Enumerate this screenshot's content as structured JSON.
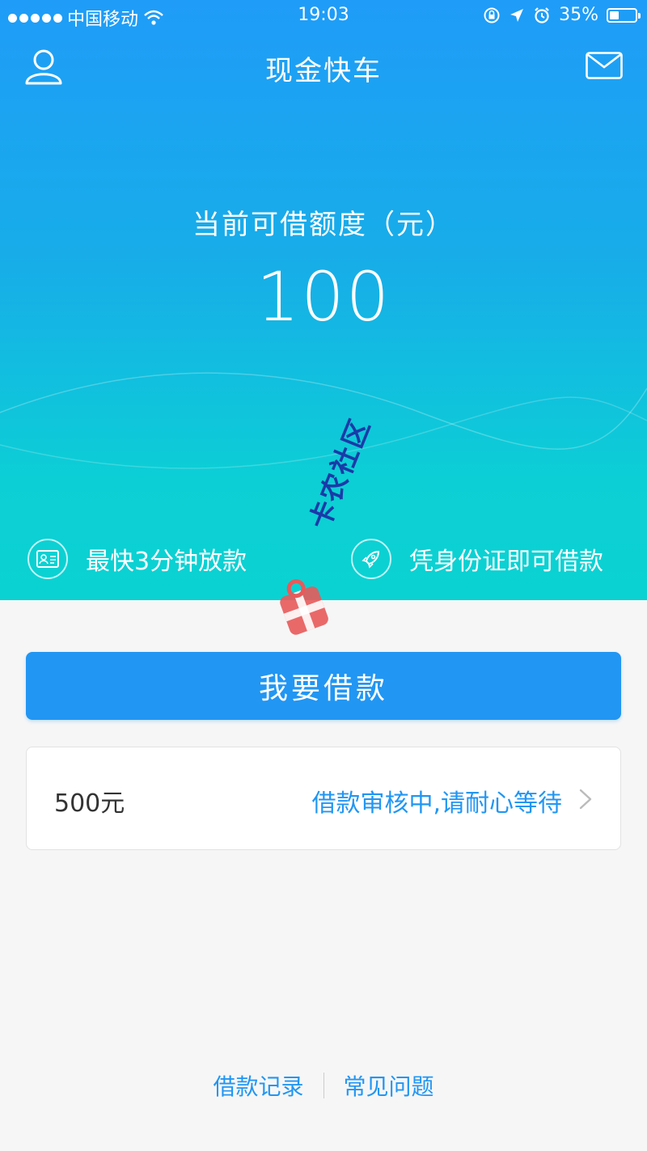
{
  "status_bar": {
    "carrier": "中国移动",
    "time": "19:03",
    "battery_percent": "35%",
    "battery_level": 0.35,
    "icons": [
      "signal-dots-icon",
      "wifi-icon",
      "rotation-lock-icon",
      "location-arrow-icon",
      "alarm-icon",
      "battery-icon"
    ]
  },
  "nav": {
    "title": "现金快车",
    "left_icon": "user-icon",
    "right_icon": "mail-icon"
  },
  "credit": {
    "label": "当前可借额度（元）",
    "amount": "100"
  },
  "features": [
    {
      "icon": "id-card-icon",
      "label": "最快3分钟放款"
    },
    {
      "icon": "rocket-icon",
      "label": "凭身份证即可借款"
    }
  ],
  "actions": {
    "borrow_button": "我要借款"
  },
  "loan_status": {
    "amount": "500元",
    "status": "借款审核中,请耐心等待",
    "icon": "chevron-right-icon"
  },
  "footer": {
    "links": [
      "借款记录",
      "常见问题"
    ]
  },
  "watermark": {
    "text": "卡农社区"
  },
  "colors": {
    "primary": "#2196f3",
    "gradient_top": "#1f9cf8",
    "gradient_bottom": "#0bd2d2",
    "background": "#f6f6f6"
  }
}
